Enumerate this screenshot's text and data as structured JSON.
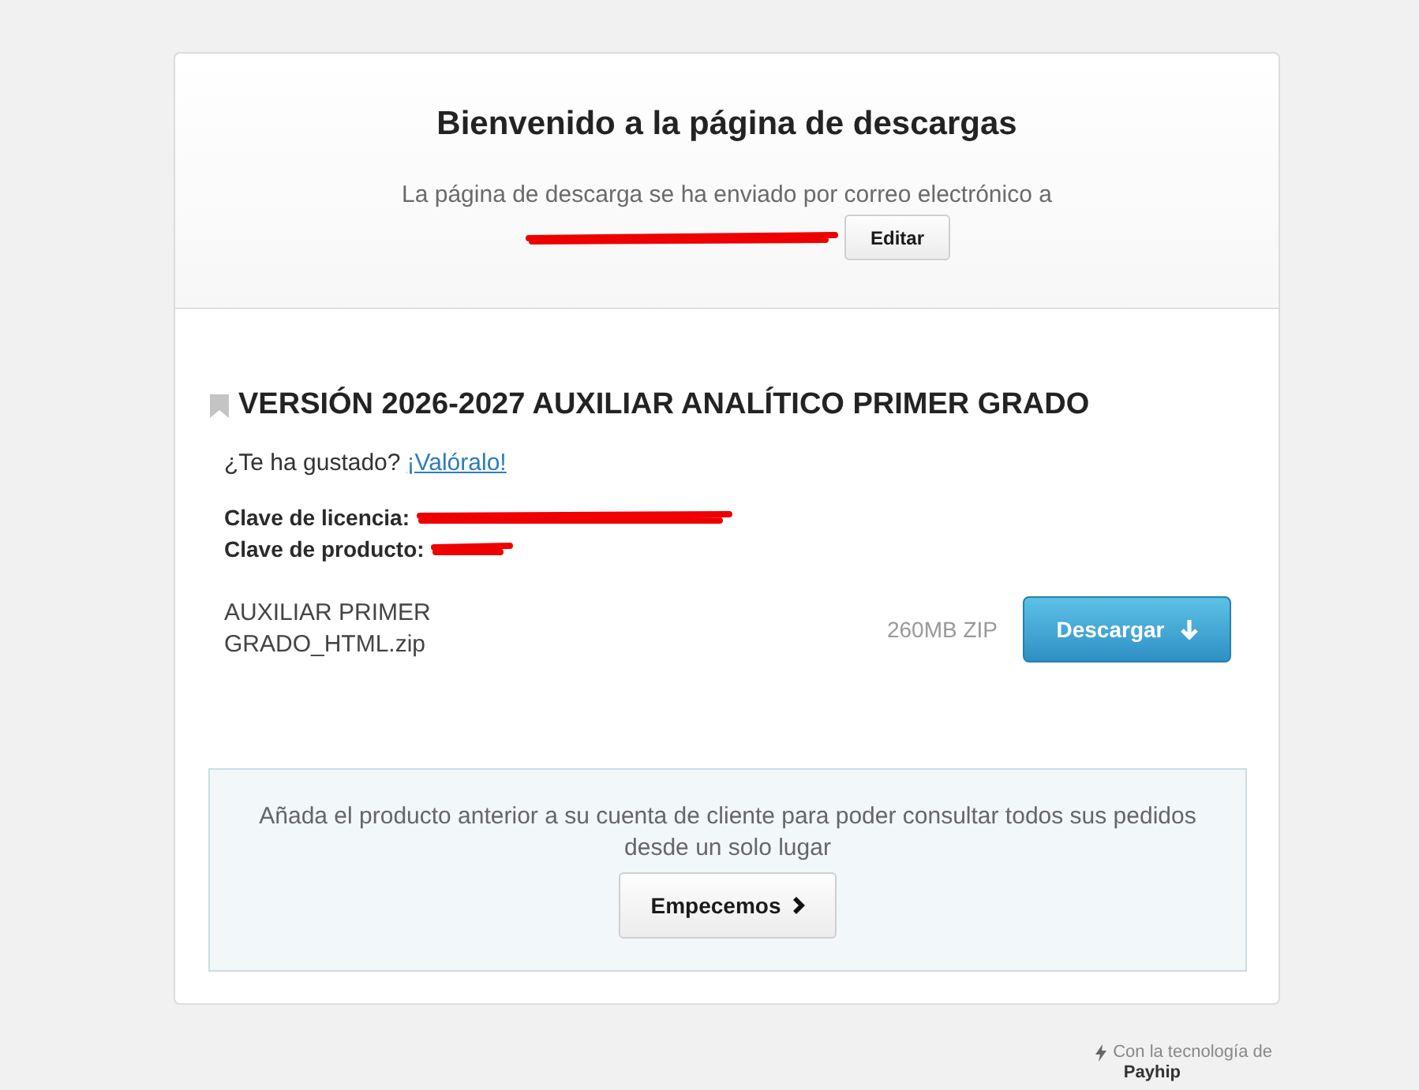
{
  "header": {
    "title": "Bienvenido a la página de descargas",
    "message": "La página de descarga se ha enviado por correo electrónico a",
    "edit_button": "Editar"
  },
  "product": {
    "title": "VERSIÓN 2026-2027 AUXILIAR ANALÍTICO PRIMER GRADO",
    "rating_prompt": "¿Te ha gustado?",
    "rating_link": "¡Valóralo!",
    "keys": [
      {
        "label": "Clave de licencia:"
      },
      {
        "label": "Clave de producto:"
      }
    ],
    "files": [
      {
        "name": "AUXILIAR PRIMER GRADO_HTML.zip",
        "size": "260MB ZIP",
        "button": "Descargar"
      }
    ]
  },
  "account_callout": {
    "message": "Añada el producto anterior a su cuenta de cliente para poder consultar todos sus pedidos desde un solo lugar",
    "button": "Empecemos"
  },
  "footer": {
    "powered_by": "Con la tecnología de",
    "brand": "Payhip"
  }
}
